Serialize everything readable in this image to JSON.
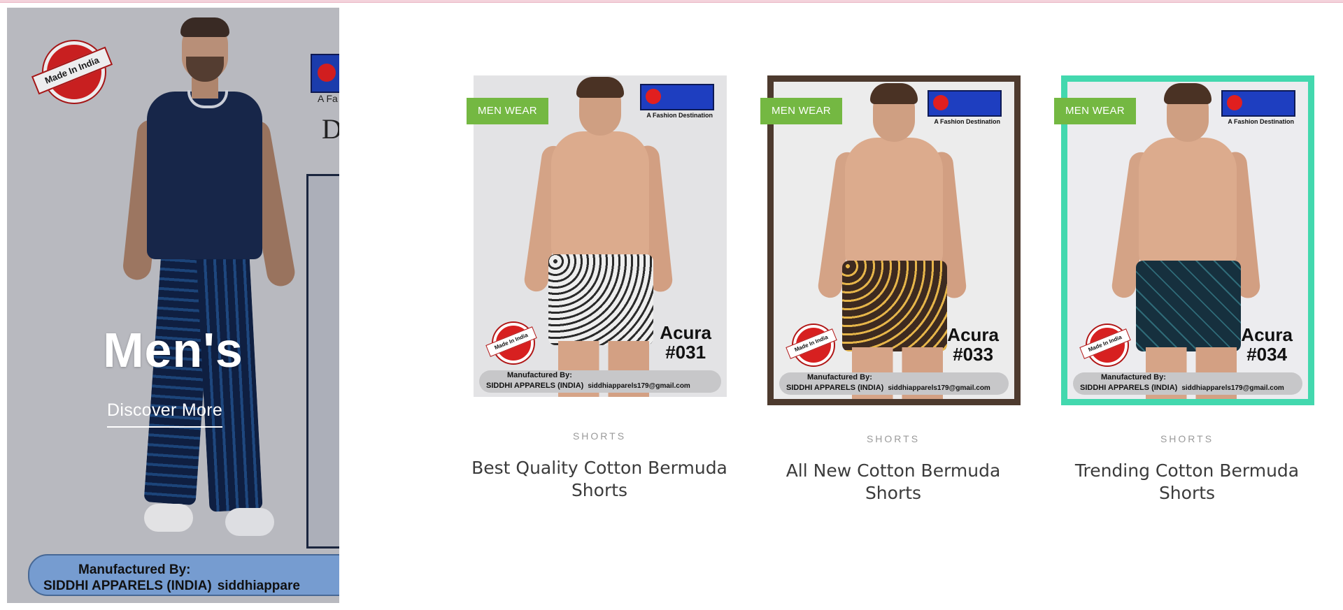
{
  "banner": {
    "title": "Men's",
    "cta_label": "Discover More",
    "stamp_text": "Made In India",
    "bg_tagline": "A Fa",
    "bg_letter": "D",
    "mfg_line1": "Manufactured By:",
    "mfg_line2": "SIDDHI APPARELS (INDIA)",
    "mfg_email": "siddhiappare"
  },
  "products": [
    {
      "tag": "MEN WEAR",
      "category": "SHORTS",
      "title": "Best Quality Cotton Bermuda Shorts",
      "model_line1": "Acura",
      "model_line2": "#031",
      "logo_tagline": "A Fashion Destination",
      "stamp_text": "Made In India",
      "mfg_line1": "Manufactured By:",
      "mfg_line2": "SIDDHI APPARELS (INDIA)",
      "mfg_email": "siddhiapparels179@gmail.com",
      "frame_color": "none"
    },
    {
      "tag": "MEN WEAR",
      "category": "SHORTS",
      "title": "All New Cotton Bermuda Shorts",
      "model_line1": "Acura",
      "model_line2": "#033",
      "logo_tagline": "A Fashion Destination",
      "stamp_text": "Made In India",
      "mfg_line1": "Manufactured By:",
      "mfg_line2": "SIDDHI APPARELS (INDIA)",
      "mfg_email": "siddhiapparels179@gmail.com",
      "frame_color": "#4d3a2e"
    },
    {
      "tag": "MEN WEAR",
      "category": "SHORTS",
      "title": "Trending Cotton Bermuda Shorts",
      "model_line1": "Acura",
      "model_line2": "#034",
      "logo_tagline": "A Fashion Destination",
      "stamp_text": "Made In India",
      "mfg_line1": "Manufactured By:",
      "mfg_line2": "SIDDHI APPARELS (INDIA)",
      "mfg_email": "siddhiapparels179@gmail.com",
      "frame_color": "#43d8ae"
    }
  ],
  "colors": {
    "tag_green": "#74b842",
    "title_text": "#3b3b3b",
    "category_text": "#9a9a9a"
  }
}
